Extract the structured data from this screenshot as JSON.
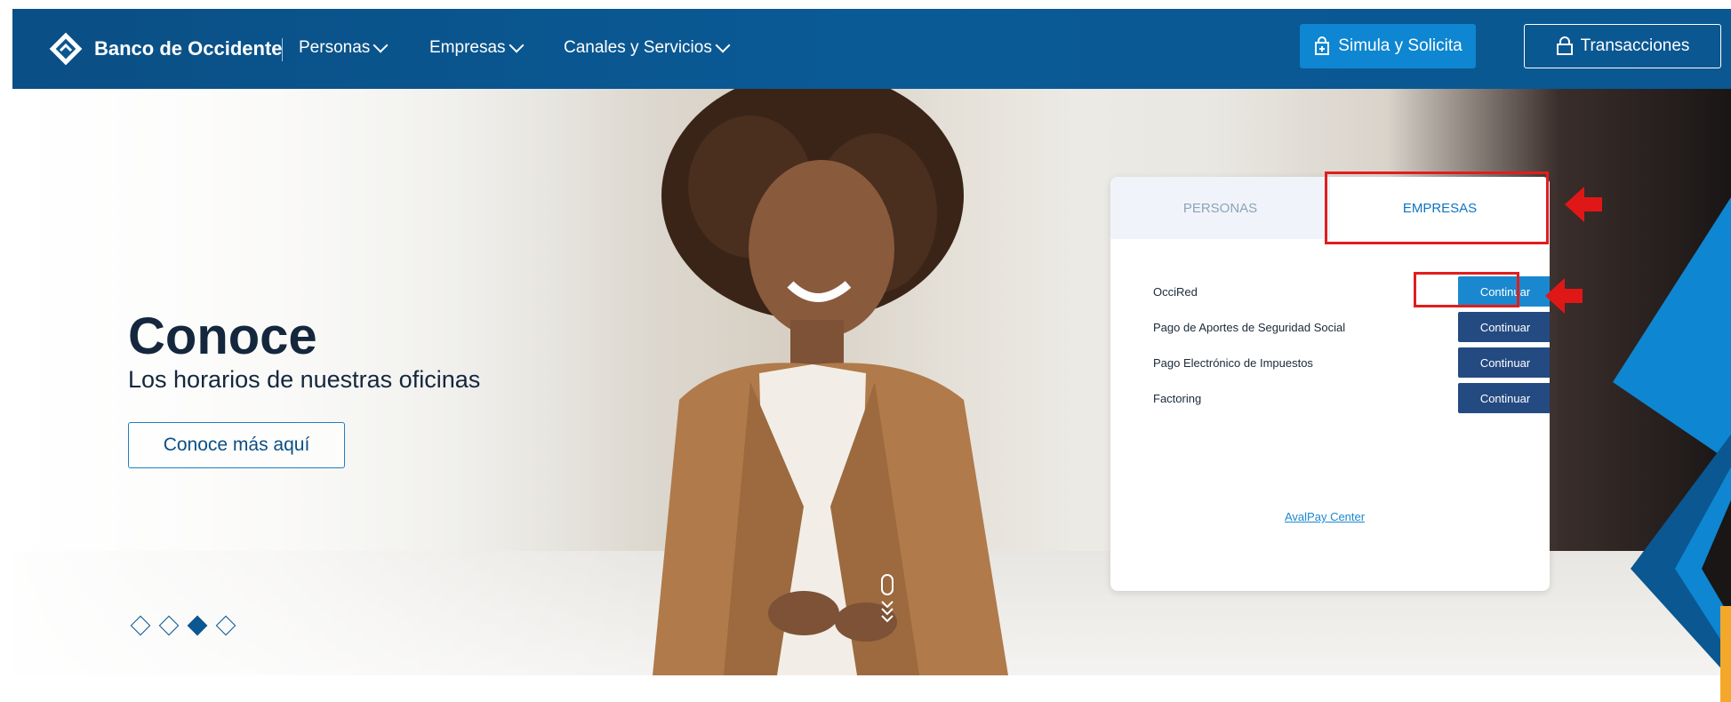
{
  "nav": {
    "brand": "Banco de Occidente",
    "menu": [
      {
        "label": "Personas"
      },
      {
        "label": "Empresas"
      },
      {
        "label": "Canales y Servicios"
      }
    ],
    "simula_label": "Simula y Solicita",
    "transacciones_label": "Transacciones"
  },
  "hero": {
    "title": "Conoce",
    "subtitle": "Los horarios de nuestras oficinas",
    "cta_label": "Conoce más aquí",
    "carousel": {
      "count": 4,
      "active_index": 3
    }
  },
  "panel": {
    "tabs": [
      {
        "label": "PERSONAS",
        "active": false
      },
      {
        "label": "EMPRESAS",
        "active": true
      }
    ],
    "rows": [
      {
        "label": "OcciRed",
        "button": "Continuar"
      },
      {
        "label": "Pago de Aportes de Seguridad Social",
        "button": "Continuar"
      },
      {
        "label": "Pago Electrónico de Impuestos",
        "button": "Continuar"
      },
      {
        "label": "Factoring",
        "button": "Continuar"
      }
    ],
    "link": "AvalPay Center"
  },
  "colors": {
    "nav_bg": "#0a5791",
    "accent": "#1a88cf",
    "button_dark": "#244a82",
    "highlight": "#e11d1d",
    "text_dark": "#14273d"
  }
}
